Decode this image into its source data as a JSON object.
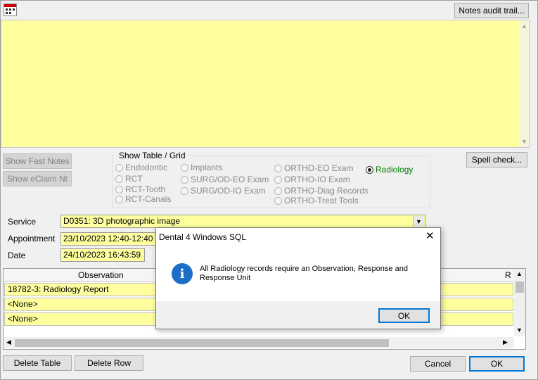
{
  "toolbar": {
    "app_icon": "calendar-icon",
    "notes_audit_label": "Notes audit trail..."
  },
  "buttons": {
    "show_fast_notes": "Show Fast Notes",
    "show_eclaim": "Show eClaim Nt",
    "spell_check": "Spell check...",
    "delete_table": "Delete Table",
    "delete_row": "Delete Row",
    "cancel": "Cancel",
    "ok": "OK"
  },
  "show_table": {
    "title": "Show Table / Grid",
    "options": {
      "endodontic": "Endodontic",
      "rct": "RCT",
      "rct_tooth": "RCT-Tooth",
      "rct_canals": "RCT-Canals",
      "implants": "Implants",
      "surg_eo": "SURG/OD-EO Exam",
      "surg_io": "SURG/OD-IO Exam",
      "ortho_eo": "ORTHO-EO Exam",
      "ortho_io": "ORTHO-IO Exam",
      "ortho_diag": "ORTHO-Diag Records",
      "ortho_treat": "ORTHO-Treat Tools",
      "radiology": "Radiology"
    },
    "selected": "Radiology"
  },
  "form": {
    "service_label": "Service",
    "service_value": "D0351: 3D photographic image",
    "appointment_label": "Appointment",
    "appointment_value": "23/10/2023 12:40-12:40",
    "date_label": "Date",
    "date_value": "24/10/2023 16:43:59"
  },
  "grid": {
    "columns": [
      "Observation",
      "R"
    ],
    "rows": [
      "18782-3: Radiology Report",
      "<None>",
      "<None>"
    ]
  },
  "dialog": {
    "title": "Dental 4 Windows SQL",
    "message": "All Radiology records require an Observation, Response and Response Unit",
    "ok": "OK",
    "icon": "info-icon"
  },
  "colors": {
    "note_bg": "#ffffa0",
    "accent": "#0078d7",
    "radiology_text": "#008000"
  }
}
